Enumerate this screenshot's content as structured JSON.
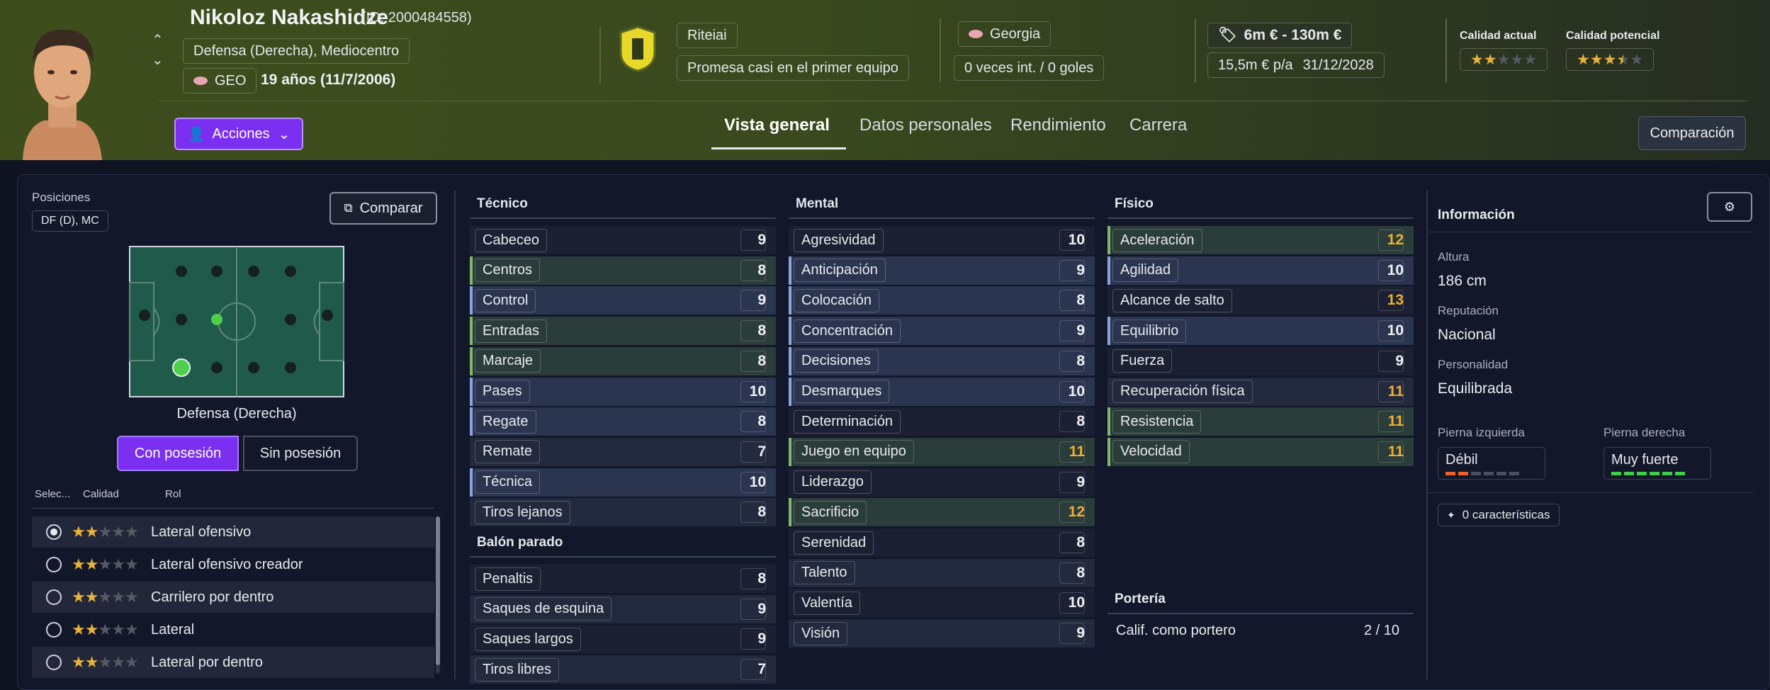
{
  "player": {
    "name": "Nikoloz Nakashidze",
    "id_text": "(ID: 2000484558)",
    "positions": "Defensa (Derecha), Mediocentro",
    "nation_code": "GEO",
    "age": "19 años (11/7/2006)",
    "club": "Riteiai",
    "status": "Promesa casi en el primer equipo",
    "country": "Georgia",
    "caps": "0 veces int. / 0 goles",
    "value": "6m € - 130m €",
    "wage": "15,5m € p/a",
    "contract_end": "31/12/2028",
    "current_ability_label": "Calidad actual",
    "potential_ability_label": "Calidad potencial",
    "current_ability_stars": 2,
    "potential_ability_stars": 3.5
  },
  "actions": {
    "label": "Acciones",
    "compare_label": "Comparación",
    "compare_short": "Comparar"
  },
  "tabs": [
    {
      "label": "Vista general",
      "active": true
    },
    {
      "label": "Datos personales"
    },
    {
      "label": "Rendimiento"
    },
    {
      "label": "Carrera"
    }
  ],
  "positions_panel": {
    "title": "Posiciones",
    "badge": "DF (D), MC",
    "selected_position": "Defensa (Derecha)",
    "toggle_in": "Con posesión",
    "toggle_out": "Sin posesión",
    "col_select": "Selec...",
    "col_quality": "Calidad",
    "col_role": "Rol",
    "roles": [
      {
        "name": "Lateral ofensivo",
        "stars": 2,
        "selected": true
      },
      {
        "name": "Lateral ofensivo creador",
        "stars": 2
      },
      {
        "name": "Carrilero por dentro",
        "stars": 2
      },
      {
        "name": "Lateral",
        "stars": 2
      },
      {
        "name": "Lateral por dentro",
        "stars": 2
      }
    ]
  },
  "attributes": {
    "tecnico": {
      "title": "Técnico",
      "items": [
        {
          "name": "Cabeceo",
          "value": 9,
          "hl": ""
        },
        {
          "name": "Centros",
          "value": 8,
          "hl": "g"
        },
        {
          "name": "Control",
          "value": 9,
          "hl": "b"
        },
        {
          "name": "Entradas",
          "value": 8,
          "hl": "g"
        },
        {
          "name": "Marcaje",
          "value": 8,
          "hl": "g"
        },
        {
          "name": "Pases",
          "value": 10,
          "hl": "b"
        },
        {
          "name": "Regate",
          "value": 8,
          "hl": "b"
        },
        {
          "name": "Remate",
          "value": 7,
          "hl": ""
        },
        {
          "name": "Técnica",
          "value": 10,
          "hl": "b"
        },
        {
          "name": "Tiros lejanos",
          "value": 8,
          "hl": ""
        }
      ]
    },
    "balon_parado": {
      "title": "Balón parado",
      "items": [
        {
          "name": "Penaltis",
          "value": 8,
          "hl": ""
        },
        {
          "name": "Saques de esquina",
          "value": 9,
          "hl": ""
        },
        {
          "name": "Saques largos",
          "value": 9,
          "hl": ""
        },
        {
          "name": "Tiros libres",
          "value": 7,
          "hl": ""
        }
      ]
    },
    "mental": {
      "title": "Mental",
      "items": [
        {
          "name": "Agresividad",
          "value": 10,
          "hl": ""
        },
        {
          "name": "Anticipación",
          "value": 9,
          "hl": "b"
        },
        {
          "name": "Colocación",
          "value": 8,
          "hl": "b"
        },
        {
          "name": "Concentración",
          "value": 9,
          "hl": "b"
        },
        {
          "name": "Decisiones",
          "value": 8,
          "hl": "b"
        },
        {
          "name": "Desmarques",
          "value": 10,
          "hl": "b"
        },
        {
          "name": "Determinación",
          "value": 8,
          "hl": ""
        },
        {
          "name": "Juego en equipo",
          "value": 11,
          "hl": "g"
        },
        {
          "name": "Liderazgo",
          "value": 9,
          "hl": ""
        },
        {
          "name": "Sacrificio",
          "value": 12,
          "hl": "g"
        },
        {
          "name": "Serenidad",
          "value": 8,
          "hl": ""
        },
        {
          "name": "Talento",
          "value": 8,
          "hl": ""
        },
        {
          "name": "Valentía",
          "value": 10,
          "hl": ""
        },
        {
          "name": "Visión",
          "value": 9,
          "hl": ""
        }
      ]
    },
    "fisico": {
      "title": "Físico",
      "items": [
        {
          "name": "Aceleración",
          "value": 12,
          "hl": "g"
        },
        {
          "name": "Agilidad",
          "value": 10,
          "hl": "b"
        },
        {
          "name": "Alcance de salto",
          "value": 13,
          "hl": ""
        },
        {
          "name": "Equilibrio",
          "value": 10,
          "hl": "b"
        },
        {
          "name": "Fuerza",
          "value": 9,
          "hl": ""
        },
        {
          "name": "Recuperación física",
          "value": 11,
          "hl": ""
        },
        {
          "name": "Resistencia",
          "value": 11,
          "hl": "g"
        },
        {
          "name": "Velocidad",
          "value": 11,
          "hl": "g"
        }
      ]
    },
    "porteria": {
      "title": "Portería",
      "label": "Calif. como portero",
      "value": "2 / 10"
    }
  },
  "info": {
    "title": "Información",
    "height_label": "Altura",
    "height": "186 cm",
    "reputation_label": "Reputación",
    "reputation": "Nacional",
    "personality_label": "Personalidad",
    "personality": "Equilibrada",
    "left_foot_label": "Pierna izquierda",
    "left_foot": "Débil",
    "left_foot_level": 2,
    "right_foot_label": "Pierna derecha",
    "right_foot": "Muy fuerte",
    "right_foot_level": 6,
    "traits": "0 características"
  },
  "colors": {
    "accent": "#7b2ff0",
    "high_attr": "#f0b030",
    "good_row": "#7fb86a",
    "key_row": "#8aa4e0"
  }
}
